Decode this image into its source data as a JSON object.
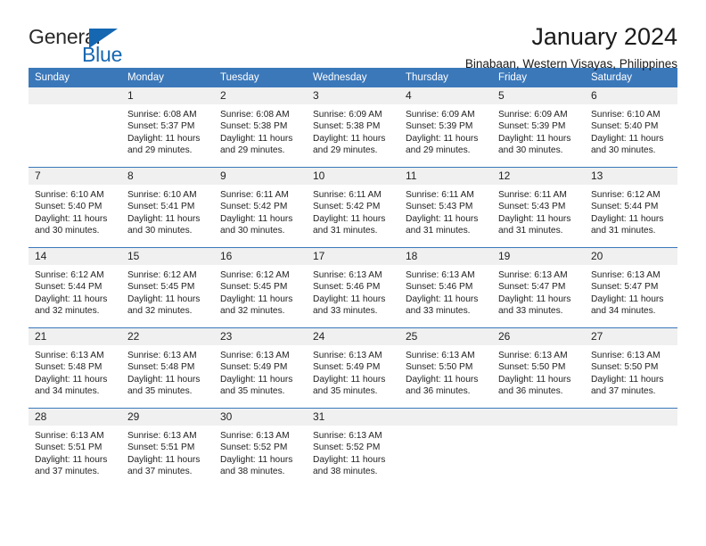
{
  "brand": {
    "name_top": "General",
    "name_bottom": "Blue",
    "triangle_icon": "triangle-icon",
    "color_blue": "#1567b2",
    "color_dark": "#2a2a2a"
  },
  "header": {
    "title": "January 2024",
    "subtitle": "Binabaan, Western Visayas, Philippines"
  },
  "calendar": {
    "header_bg": "#3b78ba",
    "daynum_bg": "#f0f0f0",
    "columns": [
      "Sunday",
      "Monday",
      "Tuesday",
      "Wednesday",
      "Thursday",
      "Friday",
      "Saturday"
    ],
    "weeks": [
      [
        {
          "day": "",
          "empty": true,
          "sunrise": "",
          "sunset": "",
          "daylight1": "",
          "daylight2": ""
        },
        {
          "day": "1",
          "sunrise": "Sunrise: 6:08 AM",
          "sunset": "Sunset: 5:37 PM",
          "daylight1": "Daylight: 11 hours",
          "daylight2": "and 29 minutes."
        },
        {
          "day": "2",
          "sunrise": "Sunrise: 6:08 AM",
          "sunset": "Sunset: 5:38 PM",
          "daylight1": "Daylight: 11 hours",
          "daylight2": "and 29 minutes."
        },
        {
          "day": "3",
          "sunrise": "Sunrise: 6:09 AM",
          "sunset": "Sunset: 5:38 PM",
          "daylight1": "Daylight: 11 hours",
          "daylight2": "and 29 minutes."
        },
        {
          "day": "4",
          "sunrise": "Sunrise: 6:09 AM",
          "sunset": "Sunset: 5:39 PM",
          "daylight1": "Daylight: 11 hours",
          "daylight2": "and 29 minutes."
        },
        {
          "day": "5",
          "sunrise": "Sunrise: 6:09 AM",
          "sunset": "Sunset: 5:39 PM",
          "daylight1": "Daylight: 11 hours",
          "daylight2": "and 30 minutes."
        },
        {
          "day": "6",
          "sunrise": "Sunrise: 6:10 AM",
          "sunset": "Sunset: 5:40 PM",
          "daylight1": "Daylight: 11 hours",
          "daylight2": "and 30 minutes."
        }
      ],
      [
        {
          "day": "7",
          "sunrise": "Sunrise: 6:10 AM",
          "sunset": "Sunset: 5:40 PM",
          "daylight1": "Daylight: 11 hours",
          "daylight2": "and 30 minutes."
        },
        {
          "day": "8",
          "sunrise": "Sunrise: 6:10 AM",
          "sunset": "Sunset: 5:41 PM",
          "daylight1": "Daylight: 11 hours",
          "daylight2": "and 30 minutes."
        },
        {
          "day": "9",
          "sunrise": "Sunrise: 6:11 AM",
          "sunset": "Sunset: 5:42 PM",
          "daylight1": "Daylight: 11 hours",
          "daylight2": "and 30 minutes."
        },
        {
          "day": "10",
          "sunrise": "Sunrise: 6:11 AM",
          "sunset": "Sunset: 5:42 PM",
          "daylight1": "Daylight: 11 hours",
          "daylight2": "and 31 minutes."
        },
        {
          "day": "11",
          "sunrise": "Sunrise: 6:11 AM",
          "sunset": "Sunset: 5:43 PM",
          "daylight1": "Daylight: 11 hours",
          "daylight2": "and 31 minutes."
        },
        {
          "day": "12",
          "sunrise": "Sunrise: 6:11 AM",
          "sunset": "Sunset: 5:43 PM",
          "daylight1": "Daylight: 11 hours",
          "daylight2": "and 31 minutes."
        },
        {
          "day": "13",
          "sunrise": "Sunrise: 6:12 AM",
          "sunset": "Sunset: 5:44 PM",
          "daylight1": "Daylight: 11 hours",
          "daylight2": "and 31 minutes."
        }
      ],
      [
        {
          "day": "14",
          "sunrise": "Sunrise: 6:12 AM",
          "sunset": "Sunset: 5:44 PM",
          "daylight1": "Daylight: 11 hours",
          "daylight2": "and 32 minutes."
        },
        {
          "day": "15",
          "sunrise": "Sunrise: 6:12 AM",
          "sunset": "Sunset: 5:45 PM",
          "daylight1": "Daylight: 11 hours",
          "daylight2": "and 32 minutes."
        },
        {
          "day": "16",
          "sunrise": "Sunrise: 6:12 AM",
          "sunset": "Sunset: 5:45 PM",
          "daylight1": "Daylight: 11 hours",
          "daylight2": "and 32 minutes."
        },
        {
          "day": "17",
          "sunrise": "Sunrise: 6:13 AM",
          "sunset": "Sunset: 5:46 PM",
          "daylight1": "Daylight: 11 hours",
          "daylight2": "and 33 minutes."
        },
        {
          "day": "18",
          "sunrise": "Sunrise: 6:13 AM",
          "sunset": "Sunset: 5:46 PM",
          "daylight1": "Daylight: 11 hours",
          "daylight2": "and 33 minutes."
        },
        {
          "day": "19",
          "sunrise": "Sunrise: 6:13 AM",
          "sunset": "Sunset: 5:47 PM",
          "daylight1": "Daylight: 11 hours",
          "daylight2": "and 33 minutes."
        },
        {
          "day": "20",
          "sunrise": "Sunrise: 6:13 AM",
          "sunset": "Sunset: 5:47 PM",
          "daylight1": "Daylight: 11 hours",
          "daylight2": "and 34 minutes."
        }
      ],
      [
        {
          "day": "21",
          "sunrise": "Sunrise: 6:13 AM",
          "sunset": "Sunset: 5:48 PM",
          "daylight1": "Daylight: 11 hours",
          "daylight2": "and 34 minutes."
        },
        {
          "day": "22",
          "sunrise": "Sunrise: 6:13 AM",
          "sunset": "Sunset: 5:48 PM",
          "daylight1": "Daylight: 11 hours",
          "daylight2": "and 35 minutes."
        },
        {
          "day": "23",
          "sunrise": "Sunrise: 6:13 AM",
          "sunset": "Sunset: 5:49 PM",
          "daylight1": "Daylight: 11 hours",
          "daylight2": "and 35 minutes."
        },
        {
          "day": "24",
          "sunrise": "Sunrise: 6:13 AM",
          "sunset": "Sunset: 5:49 PM",
          "daylight1": "Daylight: 11 hours",
          "daylight2": "and 35 minutes."
        },
        {
          "day": "25",
          "sunrise": "Sunrise: 6:13 AM",
          "sunset": "Sunset: 5:50 PM",
          "daylight1": "Daylight: 11 hours",
          "daylight2": "and 36 minutes."
        },
        {
          "day": "26",
          "sunrise": "Sunrise: 6:13 AM",
          "sunset": "Sunset: 5:50 PM",
          "daylight1": "Daylight: 11 hours",
          "daylight2": "and 36 minutes."
        },
        {
          "day": "27",
          "sunrise": "Sunrise: 6:13 AM",
          "sunset": "Sunset: 5:50 PM",
          "daylight1": "Daylight: 11 hours",
          "daylight2": "and 37 minutes."
        }
      ],
      [
        {
          "day": "28",
          "sunrise": "Sunrise: 6:13 AM",
          "sunset": "Sunset: 5:51 PM",
          "daylight1": "Daylight: 11 hours",
          "daylight2": "and 37 minutes."
        },
        {
          "day": "29",
          "sunrise": "Sunrise: 6:13 AM",
          "sunset": "Sunset: 5:51 PM",
          "daylight1": "Daylight: 11 hours",
          "daylight2": "and 37 minutes."
        },
        {
          "day": "30",
          "sunrise": "Sunrise: 6:13 AM",
          "sunset": "Sunset: 5:52 PM",
          "daylight1": "Daylight: 11 hours",
          "daylight2": "and 38 minutes."
        },
        {
          "day": "31",
          "sunrise": "Sunrise: 6:13 AM",
          "sunset": "Sunset: 5:52 PM",
          "daylight1": "Daylight: 11 hours",
          "daylight2": "and 38 minutes."
        },
        {
          "day": "",
          "empty": true,
          "sunrise": "",
          "sunset": "",
          "daylight1": "",
          "daylight2": ""
        },
        {
          "day": "",
          "empty": true,
          "sunrise": "",
          "sunset": "",
          "daylight1": "",
          "daylight2": ""
        },
        {
          "day": "",
          "empty": true,
          "sunrise": "",
          "sunset": "",
          "daylight1": "",
          "daylight2": ""
        }
      ]
    ]
  }
}
